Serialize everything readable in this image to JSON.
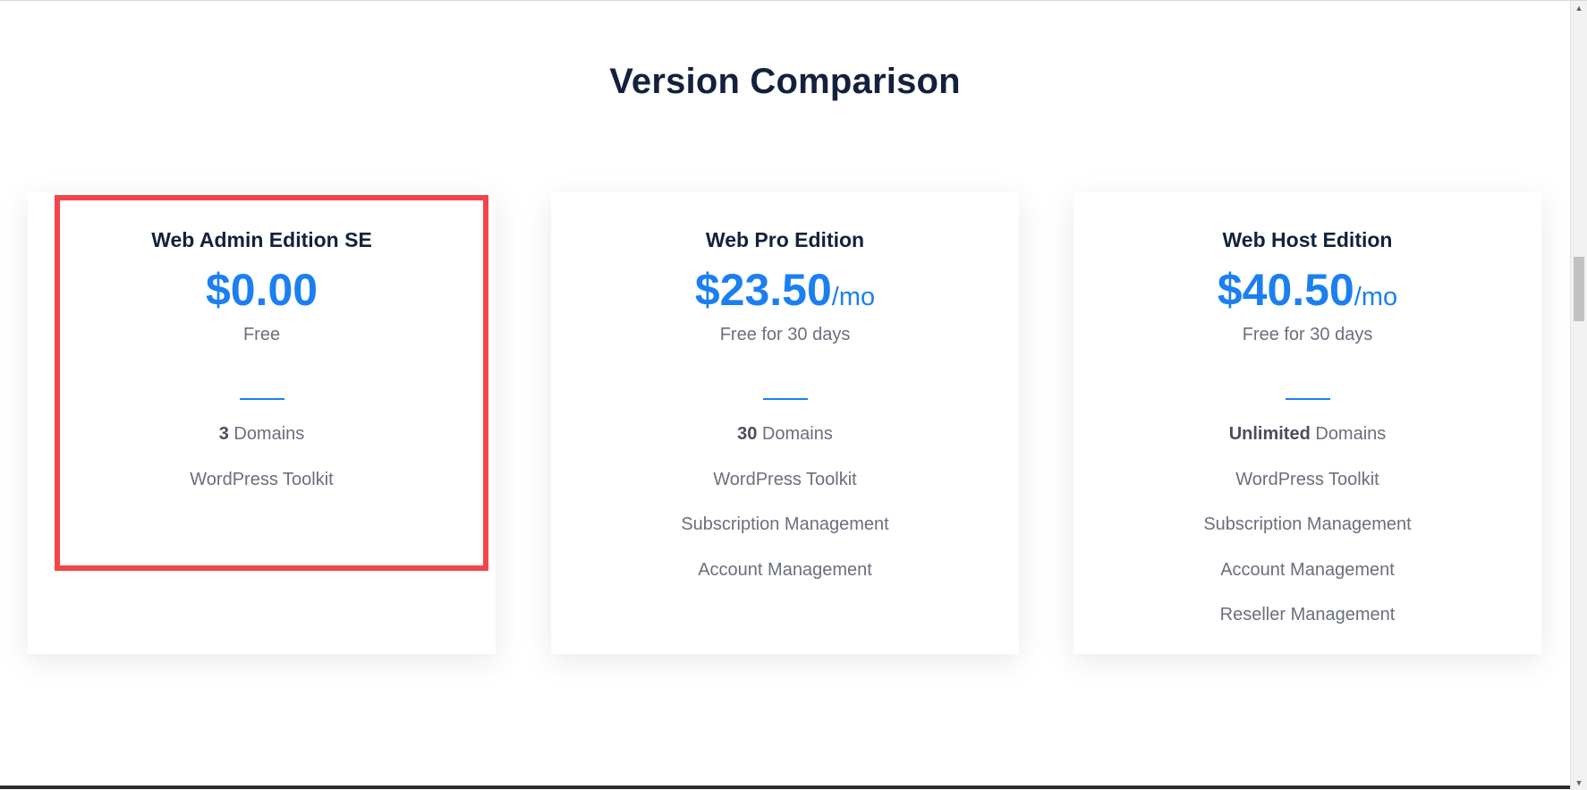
{
  "page": {
    "title": "Version Comparison"
  },
  "plans": [
    {
      "name": "Web Admin Edition SE",
      "price": "$0.00",
      "period": "",
      "note": "Free",
      "features": [
        {
          "strong": "3",
          "text": " Domains"
        },
        {
          "strong": "",
          "text": "WordPress Toolkit"
        }
      ]
    },
    {
      "name": "Web Pro Edition",
      "price": "$23.50",
      "period": "/mo",
      "note": "Free for 30 days",
      "features": [
        {
          "strong": "30",
          "text": " Domains"
        },
        {
          "strong": "",
          "text": "WordPress Toolkit"
        },
        {
          "strong": "",
          "text": "Subscription Management"
        },
        {
          "strong": "",
          "text": "Account Management"
        }
      ]
    },
    {
      "name": "Web Host Edition",
      "price": "$40.50",
      "period": "/mo",
      "note": "Free for 30 days",
      "features": [
        {
          "strong": "Unlimited",
          "text": " Domains"
        },
        {
          "strong": "",
          "text": "WordPress Toolkit"
        },
        {
          "strong": "",
          "text": "Subscription Management"
        },
        {
          "strong": "",
          "text": "Account Management"
        },
        {
          "strong": "",
          "text": "Reseller Management"
        }
      ]
    }
  ],
  "highlight": {
    "target": "plans.0",
    "color": "#f2454a"
  },
  "colors": {
    "accent": "#1b7ff2",
    "heading": "#14213d",
    "body_text": "#6b6f7d"
  },
  "scrollbar": {
    "up_icon": "triangle-up-icon",
    "down_icon": "triangle-down-icon"
  }
}
